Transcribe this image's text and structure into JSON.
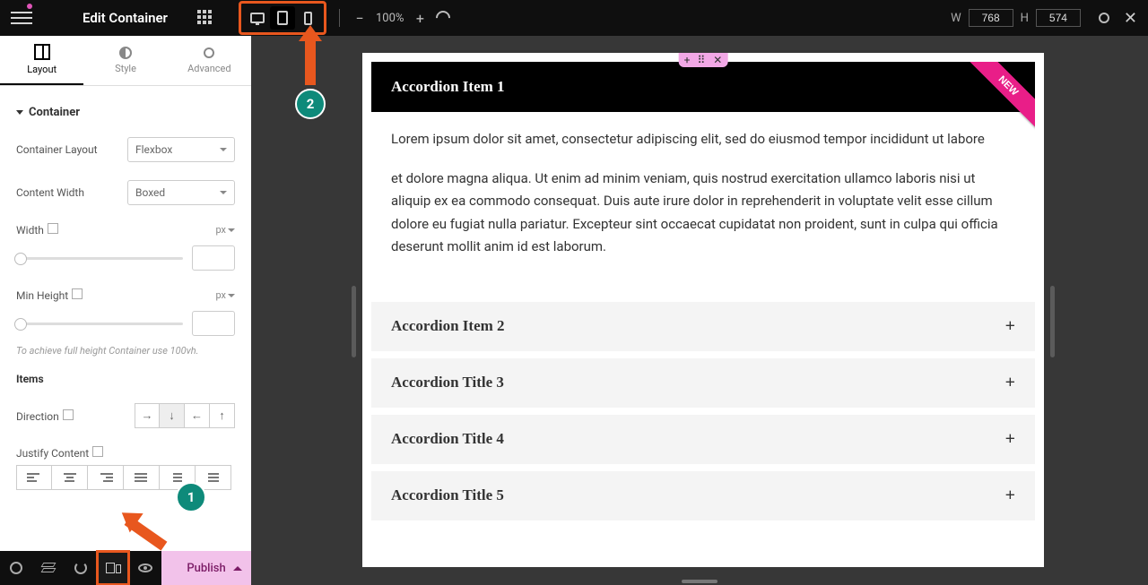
{
  "topbar": {
    "title": "Edit Container",
    "zoom": "100%",
    "width_label": "W",
    "width_value": "768",
    "height_label": "H",
    "height_value": "574"
  },
  "panel": {
    "tabs": {
      "layout": "Layout",
      "style": "Style",
      "advanced": "Advanced"
    },
    "section_container": "Container",
    "container_layout_label": "Container Layout",
    "container_layout_value": "Flexbox",
    "content_width_label": "Content Width",
    "content_width_value": "Boxed",
    "width_label": "Width",
    "width_unit": "px",
    "minheight_label": "Min Height",
    "minheight_unit": "px",
    "hint": "To achieve full height Container use 100vh.",
    "items_head": "Items",
    "direction_label": "Direction",
    "justify_label": "Justify Content"
  },
  "bottombar": {
    "publish": "Publish"
  },
  "canvas": {
    "ribbon": "NEW",
    "accordion": {
      "item1_title": "Accordion Item 1",
      "item1_p1": "Lorem ipsum dolor sit amet, consectetur adipiscing elit, sed do eiusmod tempor incididunt ut labore",
      "item1_p2": "et dolore magna aliqua. Ut enim ad minim veniam, quis nostrud exercitation ullamco laboris nisi ut aliquip ex ea commodo consequat. Duis aute irure dolor in reprehenderit in voluptate velit esse cillum dolore eu fugiat nulla pariatur. Excepteur sint occaecat cupidatat non proident, sunt in culpa qui officia deserunt mollit anim id est laborum.",
      "items": [
        "Accordion Item 2",
        "Accordion Title 3",
        "Accordion Title 4",
        "Accordion Title 5"
      ]
    }
  },
  "annotations": {
    "one": "1",
    "two": "2"
  }
}
